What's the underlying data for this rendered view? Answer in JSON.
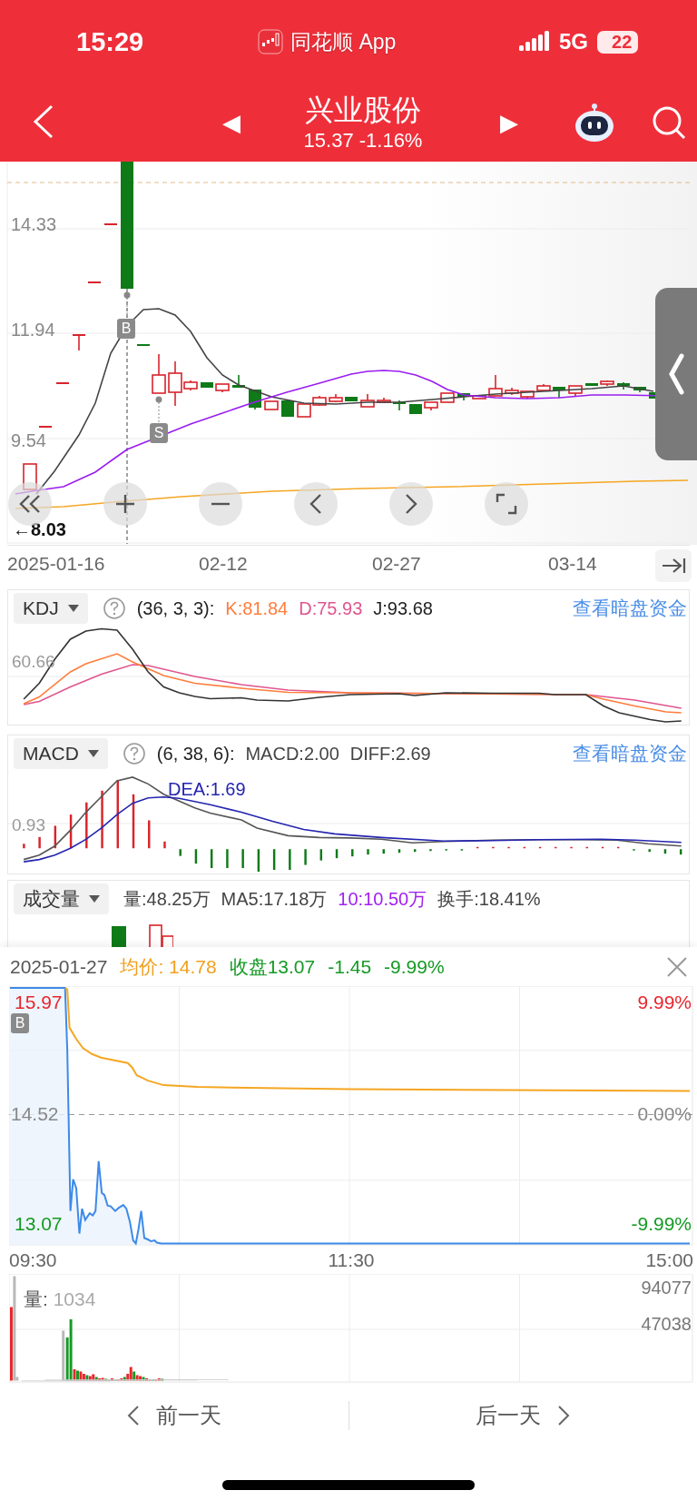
{
  "status_bar": {
    "time": "15:29",
    "app_name": "同花顺 App",
    "network": "5G",
    "battery": "22"
  },
  "header": {
    "prev": "◀",
    "title": "兴业股份",
    "quote": "15.37 -1.16%",
    "next": "▶"
  },
  "kline": {
    "y_labels": [
      "14.33",
      "11.94",
      "9.54"
    ],
    "low_label": "←8.03",
    "markers": [
      {
        "label": "B"
      },
      {
        "label": "S"
      }
    ],
    "dates": [
      "2025-01-16",
      "02-12",
      "02-27",
      "03-14"
    ]
  },
  "kdj": {
    "name": "KDJ",
    "params": "(36, 3, 3):",
    "values": [
      {
        "text": "K:81.84",
        "color": "#ff7d3b"
      },
      {
        "text": "D:75.93",
        "color": "#e0558e"
      },
      {
        "text": "J:93.68",
        "color": "#222222"
      }
    ],
    "link": "查看暗盘资金",
    "y_label": "60.66"
  },
  "macd": {
    "name": "MACD",
    "params": "(6, 38, 6):",
    "values": [
      {
        "text": "MACD:2.00",
        "color": "#444444"
      },
      {
        "text": "DIFF:2.69",
        "color": "#444444"
      }
    ],
    "dea": "DEA:1.69",
    "link": "查看暗盘资金",
    "y_label": "0.93"
  },
  "volume": {
    "name": "成交量",
    "values": [
      {
        "text": "量:48.25万",
        "color": "#444444"
      },
      {
        "text": "MA5:17.18万",
        "color": "#444444"
      },
      {
        "text": "10:10.50万",
        "color": "#a020f0"
      },
      {
        "text": "换手:18.41%",
        "color": "#444444"
      }
    ]
  },
  "intraday": {
    "date": "2025-01-27",
    "average": "均价: 14.78",
    "close": "收盘13.07",
    "change": "-1.45",
    "percent": "-9.99%",
    "high": "15.97",
    "high_pct": "9.99%",
    "mid": "14.52",
    "mid_pct": "0.00%",
    "low": "13.07",
    "low_pct": "-9.99%",
    "marker": "B",
    "times": [
      "09:30",
      "11:30",
      "15:00"
    ],
    "volume_label": "量:",
    "volume_value": "1034",
    "volume_max": "94077",
    "volume_mid": "47038"
  },
  "day_nav": {
    "prev": "前一天",
    "next": "后一天"
  }
}
